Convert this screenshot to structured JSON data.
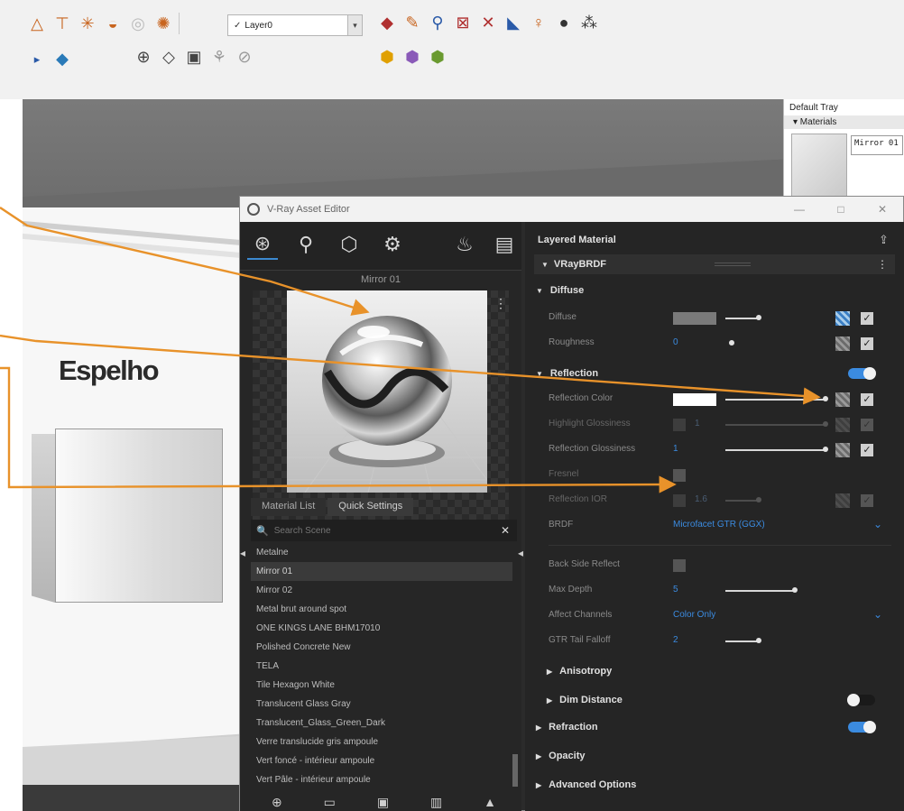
{
  "toolbar": {
    "layer": {
      "checkmark": "✓",
      "value": "Layer0",
      "dropdown_glyph": "▾"
    }
  },
  "viewport": {
    "label": "Espelho",
    "tray": {
      "title": "Default Tray",
      "section": "▾ Materials",
      "material_name": "Mirror 01"
    }
  },
  "window": {
    "title": "V-Ray Asset Editor",
    "minimize": "—",
    "maximize": "□",
    "close": "✕"
  },
  "preview": {
    "title": "Mirror 01",
    "more_glyph": "⋮"
  },
  "left_tabs": {
    "material_list": "Material List",
    "quick_settings": "Quick Settings"
  },
  "search": {
    "placeholder": "Search Scene",
    "icon_glyph": "🔍",
    "clear_glyph": "✕"
  },
  "materials": [
    "Metalne",
    "Mirror 01",
    "Mirror 02",
    "Metal brut around spot",
    "ONE KINGS LANE BHM17010",
    "Polished Concrete New",
    "TELA",
    "Tile Hexagon White",
    "Translucent Glass Gray",
    "Translucent_Glass_Green_Dark",
    "Verre translucide gris ampoule",
    "Vert foncé - intérieur ampoule",
    "Vert Pâle - intérieur ampoule"
  ],
  "selected_material_index": 1,
  "right": {
    "header": "Layered Material",
    "brdf_name": "VRayBRDF",
    "diffuse": {
      "section": "Diffuse",
      "diffuse_label": "Diffuse",
      "diffuse_color": "#7a7a7a",
      "roughness_label": "Roughness",
      "roughness_value": "0"
    },
    "reflection": {
      "section": "Reflection",
      "enabled": true,
      "color_label": "Reflection Color",
      "color_value": "#ffffff",
      "hilight_label": "Highlight Glossiness",
      "hilight_value": "1",
      "gloss_label": "Reflection Glossiness",
      "gloss_value": "1",
      "fresnel_label": "Fresnel",
      "fresnel_checked": false,
      "ior_label": "Reflection IOR",
      "ior_value": "1.6",
      "brdf_label": "BRDF",
      "brdf_value": "Microfacet GTR (GGX)",
      "backside_label": "Back Side Reflect",
      "maxdepth_label": "Max Depth",
      "maxdepth_value": "5",
      "affect_label": "Affect Channels",
      "affect_value": "Color Only",
      "gtr_label": "GTR Tail Falloff",
      "gtr_value": "2",
      "anisotropy_label": "Anisotropy",
      "dim_label": "Dim Distance",
      "dim_enabled": false
    },
    "refraction_label": "Refraction",
    "refraction_enabled": true,
    "opacity_label": "Opacity",
    "advanced_label": "Advanced Options"
  },
  "colors": {
    "accent": "#3b8be0",
    "annotation_arrow": "#e8922a"
  }
}
